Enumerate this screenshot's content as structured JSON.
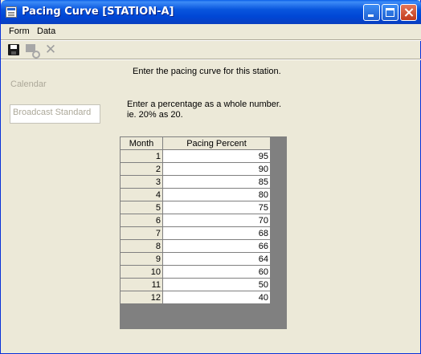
{
  "window": {
    "title": "Pacing Curve [STATION-A]"
  },
  "menu": {
    "form": "Form",
    "data": "Data"
  },
  "toolbar": {
    "save_icon": "save-icon",
    "edit_icon": "edit-icon",
    "cancel_icon": "cancel-icon"
  },
  "form": {
    "instructions": "Enter the pacing curve for this station.",
    "calendar_label": "Calendar",
    "calendar_value": "Broadcast Standard",
    "format_line1": "Enter a percentage as a whole number.",
    "format_line2": "ie. 20% as 20."
  },
  "grid": {
    "headers": [
      "Month",
      "Pacing Percent"
    ],
    "rows": [
      {
        "month": "1",
        "percent": "95"
      },
      {
        "month": "2",
        "percent": "90"
      },
      {
        "month": "3",
        "percent": "85"
      },
      {
        "month": "4",
        "percent": "80"
      },
      {
        "month": "5",
        "percent": "75"
      },
      {
        "month": "6",
        "percent": "70"
      },
      {
        "month": "7",
        "percent": "68"
      },
      {
        "month": "8",
        "percent": "66"
      },
      {
        "month": "9",
        "percent": "64"
      },
      {
        "month": "10",
        "percent": "60"
      },
      {
        "month": "11",
        "percent": "50"
      },
      {
        "month": "12",
        "percent": "40"
      }
    ]
  }
}
